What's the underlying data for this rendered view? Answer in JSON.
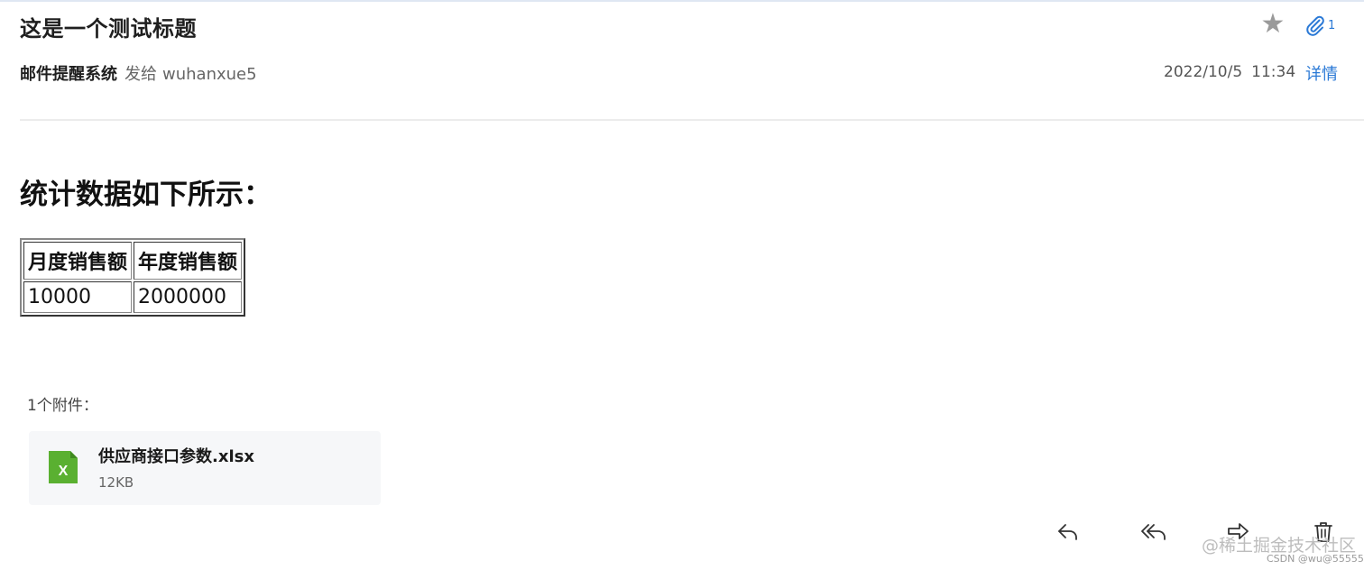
{
  "email": {
    "subject": "这是一个测试标题",
    "sender": "邮件提醒系统",
    "sent_to_label": "发给",
    "recipient": "wuhanxue5",
    "date": "2022/10/5",
    "time": "11:34",
    "details_label": "详情",
    "attachment_count": "1",
    "starred": false
  },
  "body": {
    "heading": "统计数据如下所示：",
    "table": {
      "headers": [
        "月度销售额",
        "年度销售额"
      ],
      "rows": [
        [
          "10000",
          "2000000"
        ]
      ]
    }
  },
  "attachments": {
    "label": "1个附件：",
    "items": [
      {
        "name": "供应商接口参数.xlsx",
        "size": "12KB",
        "icon": "excel-file-icon",
        "icon_letter": "X"
      }
    ]
  },
  "actions": [
    {
      "name": "reply",
      "icon": "reply-icon"
    },
    {
      "name": "reply-all",
      "icon": "reply-all-icon"
    },
    {
      "name": "forward",
      "icon": "forward-icon"
    },
    {
      "name": "delete",
      "icon": "trash-icon"
    }
  ],
  "watermark": {
    "main": "@稀土掘金技术社区",
    "sub": "CSDN @wu@55555"
  },
  "colors": {
    "accent": "#2a79d6",
    "excel_green": "#5ab031",
    "star_gray": "#9a9a9a"
  }
}
